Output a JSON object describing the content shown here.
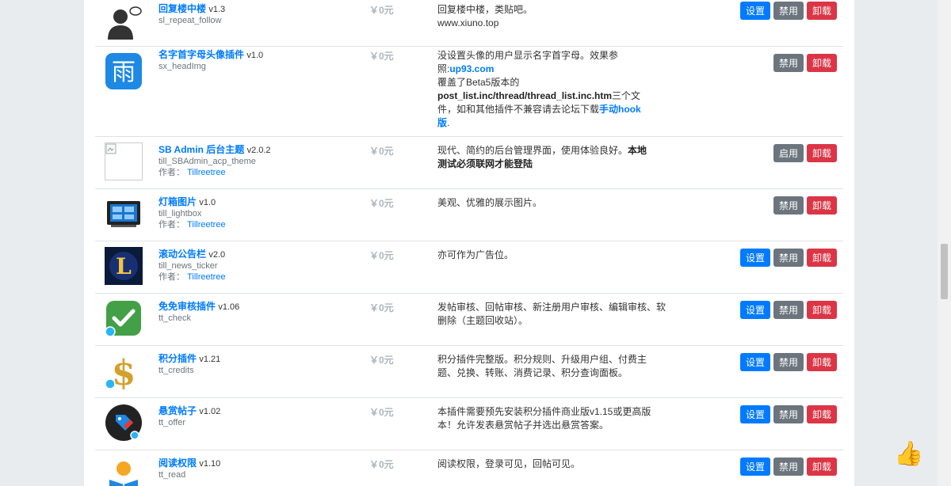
{
  "rows": [
    {
      "name": "回复楼中楼",
      "version": "v1.3",
      "dir": "sl_repeat_follow",
      "price": "￥0元",
      "desc": "回复楼中楼，类贴吧。",
      "desc2": "www.xiuno.top",
      "buttons": [
        "设置",
        "禁用",
        "卸载"
      ]
    },
    {
      "name": "名字首字母头像插件",
      "version": "v1.0",
      "dir": "sx_headImg",
      "price": "￥0元",
      "desc_a": "没设置头像的用户显示名字首字母。效果参照:",
      "desc_link": "up93.com",
      "desc_b": "覆盖了Beta5版本的",
      "desc_bold": "post_list.inc/thread/thread_list.inc.htm",
      "desc_c": "三个文件，如和其他插件不兼容请去论坛下载",
      "desc_link2": "手动hook版",
      "desc_d": ".",
      "buttons": [
        "禁用",
        "卸载"
      ]
    },
    {
      "name": "SB Admin 后台主题",
      "version": "v2.0.2",
      "dir": "till_SBAdmin_acp_theme",
      "author_label": "作者：",
      "author": "Tillreetree",
      "price": "￥0元",
      "desc_a": "现代、简约的后台管理界面，使用体验良好。",
      "desc_bold": "本地测试必须联网才能登陆",
      "buttons": [
        "启用",
        "卸载"
      ]
    },
    {
      "name": "灯箱图片",
      "version": "v1.0",
      "dir": "till_lightbox",
      "author_label": "作者：",
      "author": "Tillreetree",
      "price": "￥0元",
      "desc": "美观、优雅的展示图片。",
      "buttons": [
        "禁用",
        "卸载"
      ]
    },
    {
      "name": "滚动公告栏",
      "version": "v2.0",
      "dir": "till_news_ticker",
      "author_label": "作者：",
      "author": "Tillreetree",
      "price": "￥0元",
      "desc": "亦可作为广告位。",
      "buttons": [
        "设置",
        "禁用",
        "卸载"
      ]
    },
    {
      "name": "免免审核插件",
      "version": "v1.06",
      "dir": "tt_check",
      "price": "￥0元",
      "desc": "发帖审核、回帖审核、新注册用户审核、编辑审核、软删除（主题回收站）。",
      "buttons": [
        "设置",
        "禁用",
        "卸载"
      ]
    },
    {
      "name": "积分插件",
      "version": "v1.21",
      "dir": "tt_credits",
      "price": "￥0元",
      "desc": "积分插件完整版。积分规则、升级用户组、付费主题、兑换、转账、消费记录、积分查询面板。",
      "buttons": [
        "设置",
        "禁用",
        "卸载"
      ]
    },
    {
      "name": "悬赏帖子",
      "version": "v1.02",
      "dir": "tt_offer",
      "price": "￥0元",
      "desc": "本插件需要预先安装积分插件商业版v1.15或更高版本！允许发表悬赏帖子并选出悬赏答案。",
      "buttons": [
        "设置",
        "禁用",
        "卸载"
      ]
    },
    {
      "name": "阅读权限",
      "version": "v1.10",
      "dir": "tt_read",
      "price": "￥0元",
      "desc": "阅读权限，登录可见，回帖可见。",
      "buttons": [
        "设置",
        "禁用",
        "卸载"
      ]
    }
  ],
  "icons": [
    "user-chat-icon",
    "rain-char-icon",
    "broken-image-icon",
    "lightbox-monitor-icon",
    "news-ticker-icon",
    "check-badge-icon",
    "dollar-icon",
    "price-tag-icon",
    "reader-icon"
  ],
  "colors": {
    "primary": "#007bff",
    "secondary": "#6c757d",
    "danger": "#dc3545"
  }
}
